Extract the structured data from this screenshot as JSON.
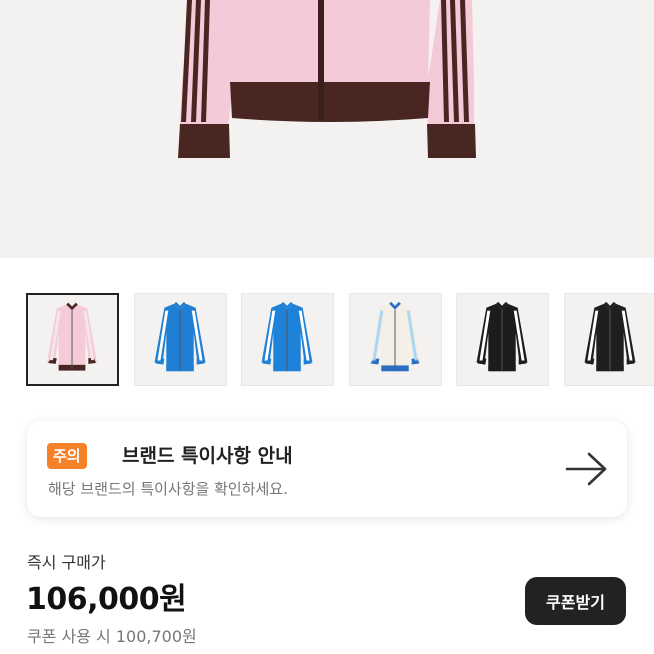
{
  "hero": {
    "image_icon": "jacket-image",
    "colors": {
      "body": "#f4c9d8",
      "trim": "#4a2623",
      "stripe": "#f6e6ea"
    }
  },
  "thumbnails": [
    {
      "icon": "jacket-pink-brown-thumbnail",
      "body": "#f4cbd6",
      "trim": "#4a2623",
      "stripe": "#f6e6ea",
      "selected": true
    },
    {
      "icon": "jacket-blue-thumbnail",
      "body": "#1f7fd3",
      "trim": "#1f7fd3",
      "stripe": "#ffffff",
      "selected": false
    },
    {
      "icon": "jacket-blue-thumbnail",
      "body": "#1e82d8",
      "trim": "#1e82d8",
      "stripe": "#ffffff",
      "selected": false
    },
    {
      "icon": "jacket-cream-blue-thumbnail",
      "body": "#f4efe6",
      "trim": "#2a6fc4",
      "stripe": "#a9d6f2",
      "selected": false
    },
    {
      "icon": "jacket-black-thumbnail",
      "body": "#1c1c1c",
      "trim": "#1c1c1c",
      "stripe": "#ffffff",
      "selected": false
    },
    {
      "icon": "jacket-black-thumbnail",
      "body": "#1f1f1f",
      "trim": "#1f1f1f",
      "stripe": "#ffffff",
      "selected": false
    }
  ],
  "notice": {
    "badge": "주의",
    "title": "브랜드 특이사항 안내",
    "subtitle": "해당 브랜드의 특이사항을 확인하세요.",
    "arrow_icon": "arrow-right-icon",
    "badge_color": "#f5822a"
  },
  "price": {
    "label": "즉시 구매가",
    "amount": "106,000원",
    "coupon_text": "쿠폰 사용 시 100,700원",
    "coupon_button": "쿠폰받기"
  }
}
